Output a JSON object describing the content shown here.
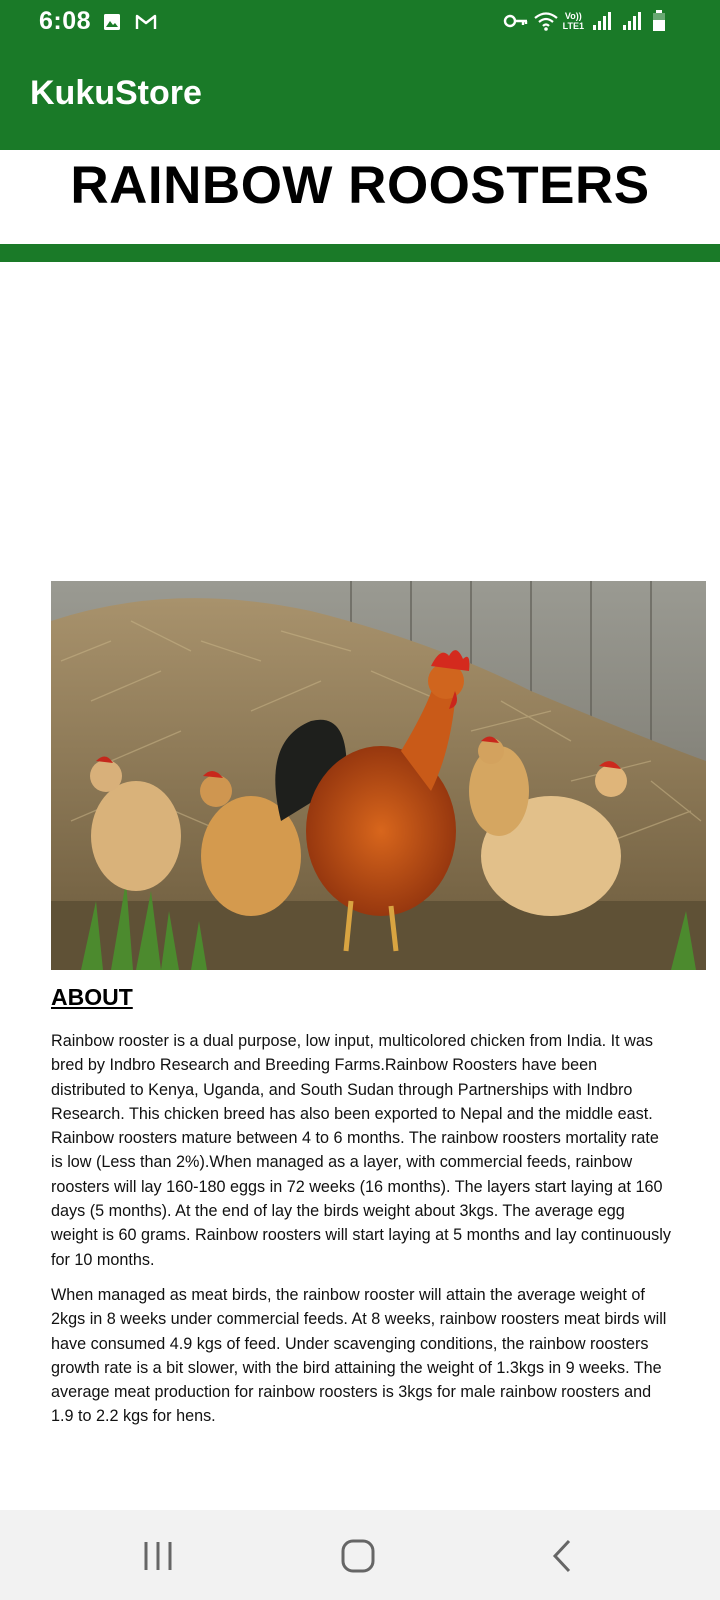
{
  "status_bar": {
    "time": "6:08",
    "lte_top": "Vo))",
    "lte_bottom": "LTE1",
    "icons": [
      "gallery-icon",
      "gmail-icon",
      "vpn-key-icon",
      "wifi-icon",
      "signal-icon",
      "signal-icon",
      "battery-icon"
    ]
  },
  "app_bar": {
    "title": "KukuStore",
    "color": "#1a7a28"
  },
  "page": {
    "heading": "RAINBOW ROOSTERS",
    "about_heading": "ABOUT",
    "paragraphs": [
      "Rainbow rooster is a dual purpose, low input, multicolored chicken from India. It was bred by Indbro Research and Breeding Farms.Rainbow Roosters have been distributed to Kenya, Uganda, and South Sudan through Partnerships with Indbro Research. This chicken breed has also been exported to Nepal and the middle east. Rainbow roosters mature between 4 to 6 months. The rainbow roosters mortality rate is low (Less than 2%).When managed as a layer, with commercial feeds, rainbow roosters will lay 160-180 eggs in 72 weeks (16 months). The layers start laying at 160 days (5 months). At the end of lay the birds weight about 3kgs. The average egg weight is 60 grams. Rainbow roosters will start laying at 5 months and lay continuously for 10 months.",
      "When managed as meat birds, the rainbow rooster will attain the average weight of 2kgs in 8 weeks under commercial feeds. At 8 weeks, rainbow roosters meat birds will have consumed 4.9 kgs of feed. Under scavenging conditions, the rainbow roosters growth rate is a bit slower, with the bird attaining the weight of 1.3kgs in 9 weeks. The average meat production for rainbow roosters is 3kgs for male rainbow roosters and 1.9 to 2.2 kgs for hens."
    ]
  },
  "nav_bar": {
    "buttons": [
      "recent-apps-icon",
      "home-icon",
      "back-icon"
    ]
  }
}
